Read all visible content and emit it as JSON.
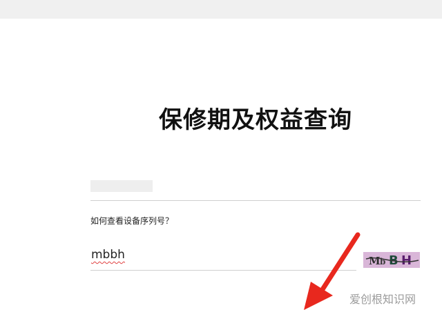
{
  "page": {
    "title": "保修期及权益查询"
  },
  "form": {
    "serial_placeholder": "",
    "help_link": "如何查看设备序列号？",
    "captcha_value": "mbbh",
    "captcha_image_text": "MbBH"
  },
  "watermark": "爱创根知识网",
  "colors": {
    "background": "#ffffff",
    "top_strip": "#f0f0f0",
    "captcha_bg": "#d9b6d8",
    "arrow": "#e8281e",
    "spellcheck_underline": "#e04040"
  },
  "icons": {
    "annotation": "red-arrow-icon"
  }
}
